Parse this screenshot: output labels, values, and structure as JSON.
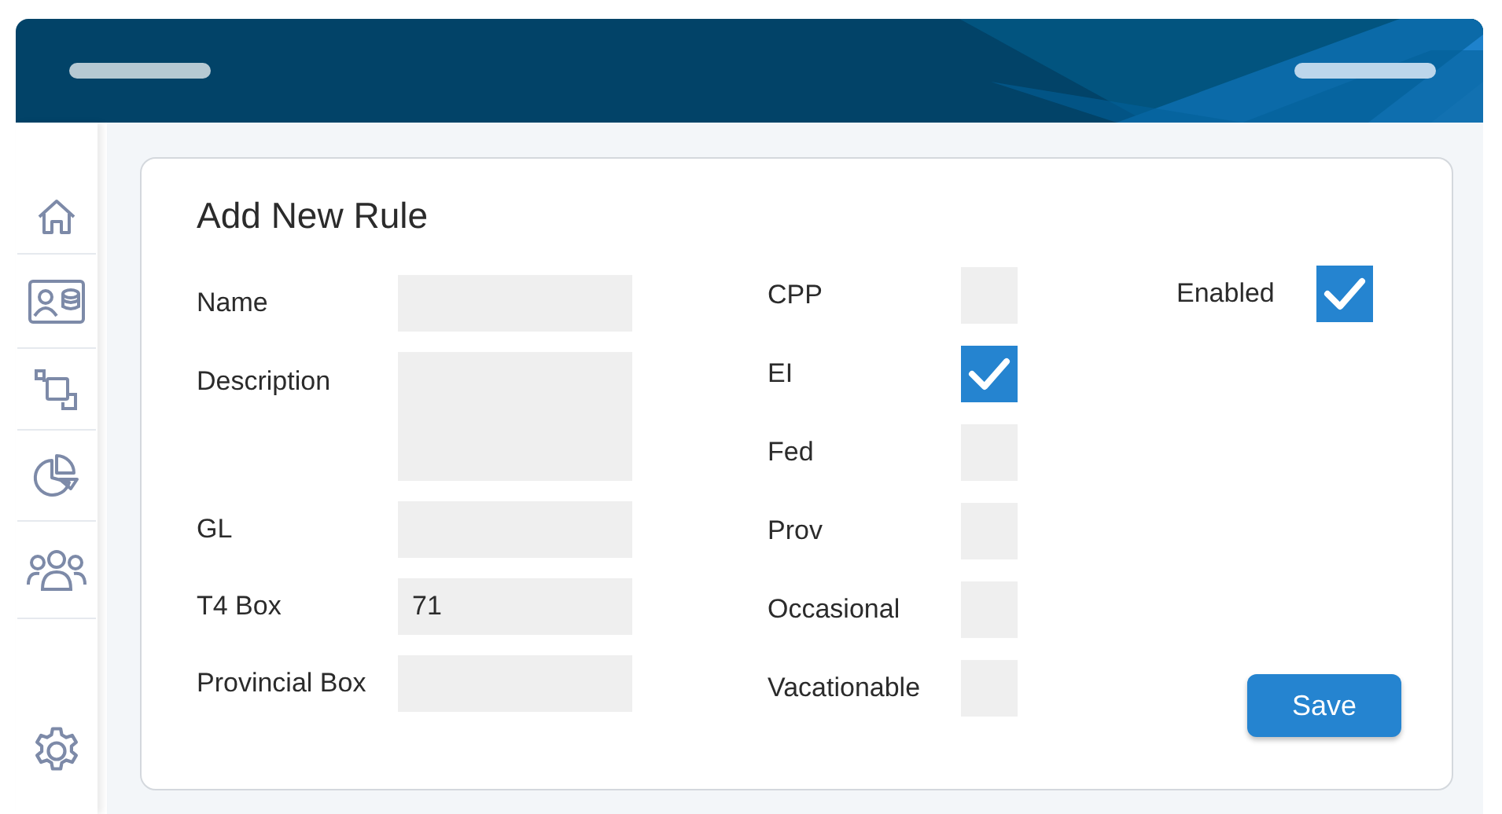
{
  "form": {
    "title": "Add New Rule",
    "fields": [
      {
        "label": "Name",
        "kind": "text"
      },
      {
        "label": "Description",
        "kind": "textarea"
      },
      {
        "label": "GL",
        "kind": "text"
      },
      {
        "label": "T4 Box",
        "kind": "text",
        "value": "71"
      },
      {
        "label": "Provincial Box",
        "kind": "text"
      }
    ],
    "options": [
      {
        "label": "CPP",
        "checked": false
      },
      {
        "label": "EI",
        "checked": true
      },
      {
        "label": "Fed",
        "checked": false
      },
      {
        "label": "Prov",
        "checked": false
      },
      {
        "label": "Occasional",
        "checked": false
      },
      {
        "label": "Vacationable",
        "checked": false
      }
    ],
    "enabled": {
      "label": "Enabled",
      "checked": true
    },
    "save_button": "Save"
  }
}
